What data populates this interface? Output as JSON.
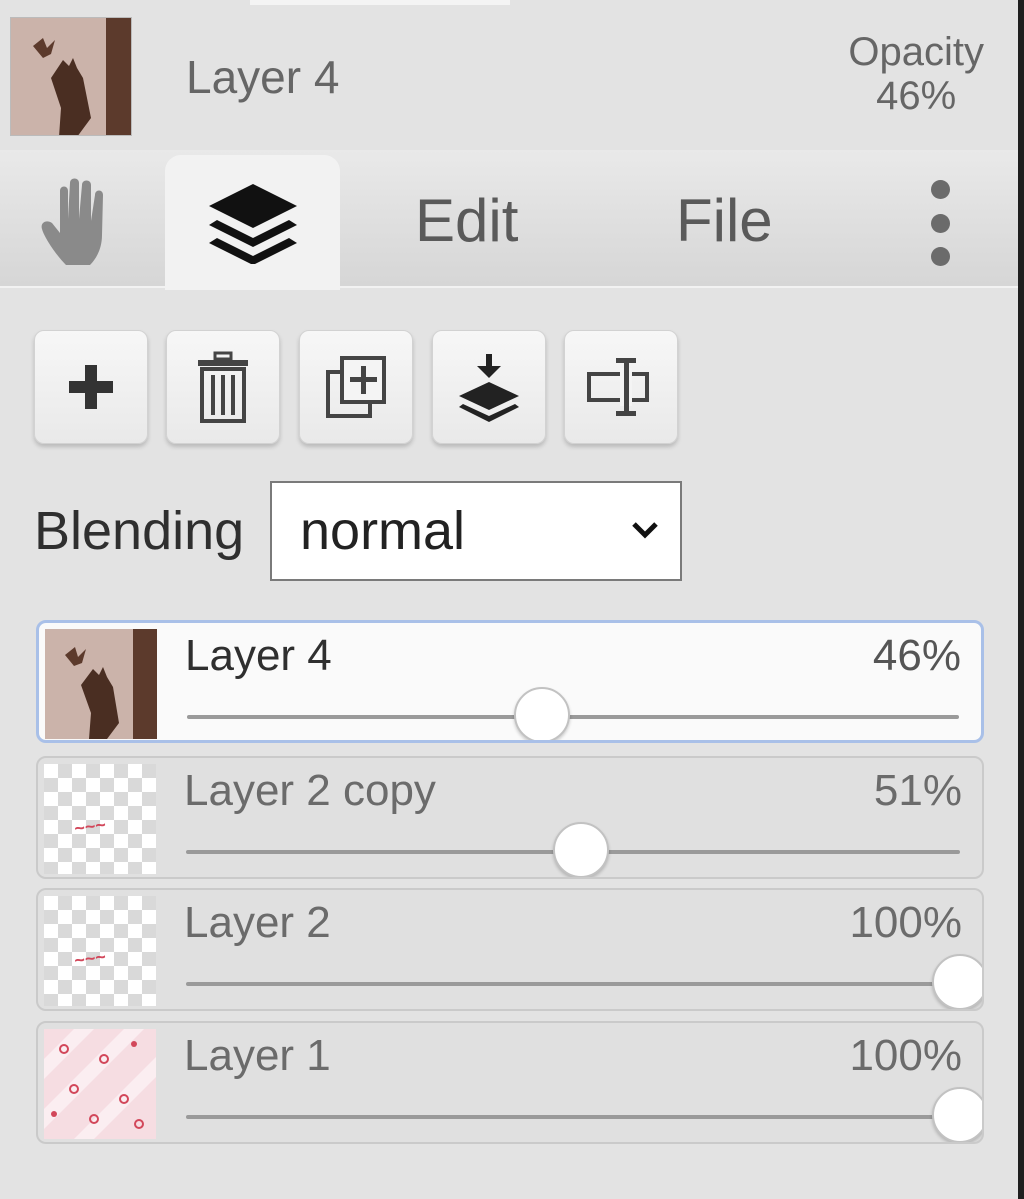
{
  "header": {
    "layer_name": "Layer 4",
    "opacity_label": "Opacity",
    "opacity_value": "46%"
  },
  "tabs": {
    "hand_icon": "hand-icon",
    "layers_icon": "layers-icon",
    "edit_label": "Edit",
    "file_label": "File",
    "more_icon": "more-vertical-icon"
  },
  "toolbar": {
    "buttons": [
      {
        "icon": "plus-icon"
      },
      {
        "icon": "trash-icon"
      },
      {
        "icon": "duplicate-icon"
      },
      {
        "icon": "merge-down-icon"
      },
      {
        "icon": "rename-icon"
      }
    ]
  },
  "blending": {
    "label": "Blending",
    "value": "normal"
  },
  "layers": [
    {
      "name": "Layer 4",
      "opacity_text": "46%",
      "opacity": 0.46,
      "active": true,
      "thumb": "photo"
    },
    {
      "name": "Layer 2 copy",
      "opacity_text": "51%",
      "opacity": 0.51,
      "active": false,
      "thumb": "transparent-text"
    },
    {
      "name": "Layer 2",
      "opacity_text": "100%",
      "opacity": 1.0,
      "active": false,
      "thumb": "transparent-text"
    },
    {
      "name": "Layer 1",
      "opacity_text": "100%",
      "opacity": 1.0,
      "active": false,
      "thumb": "pink-pattern"
    }
  ],
  "colors": {
    "panel_bg": "#e3e3e3",
    "active_border": "#a9c0e8",
    "thumb_red": "#d2475a"
  }
}
